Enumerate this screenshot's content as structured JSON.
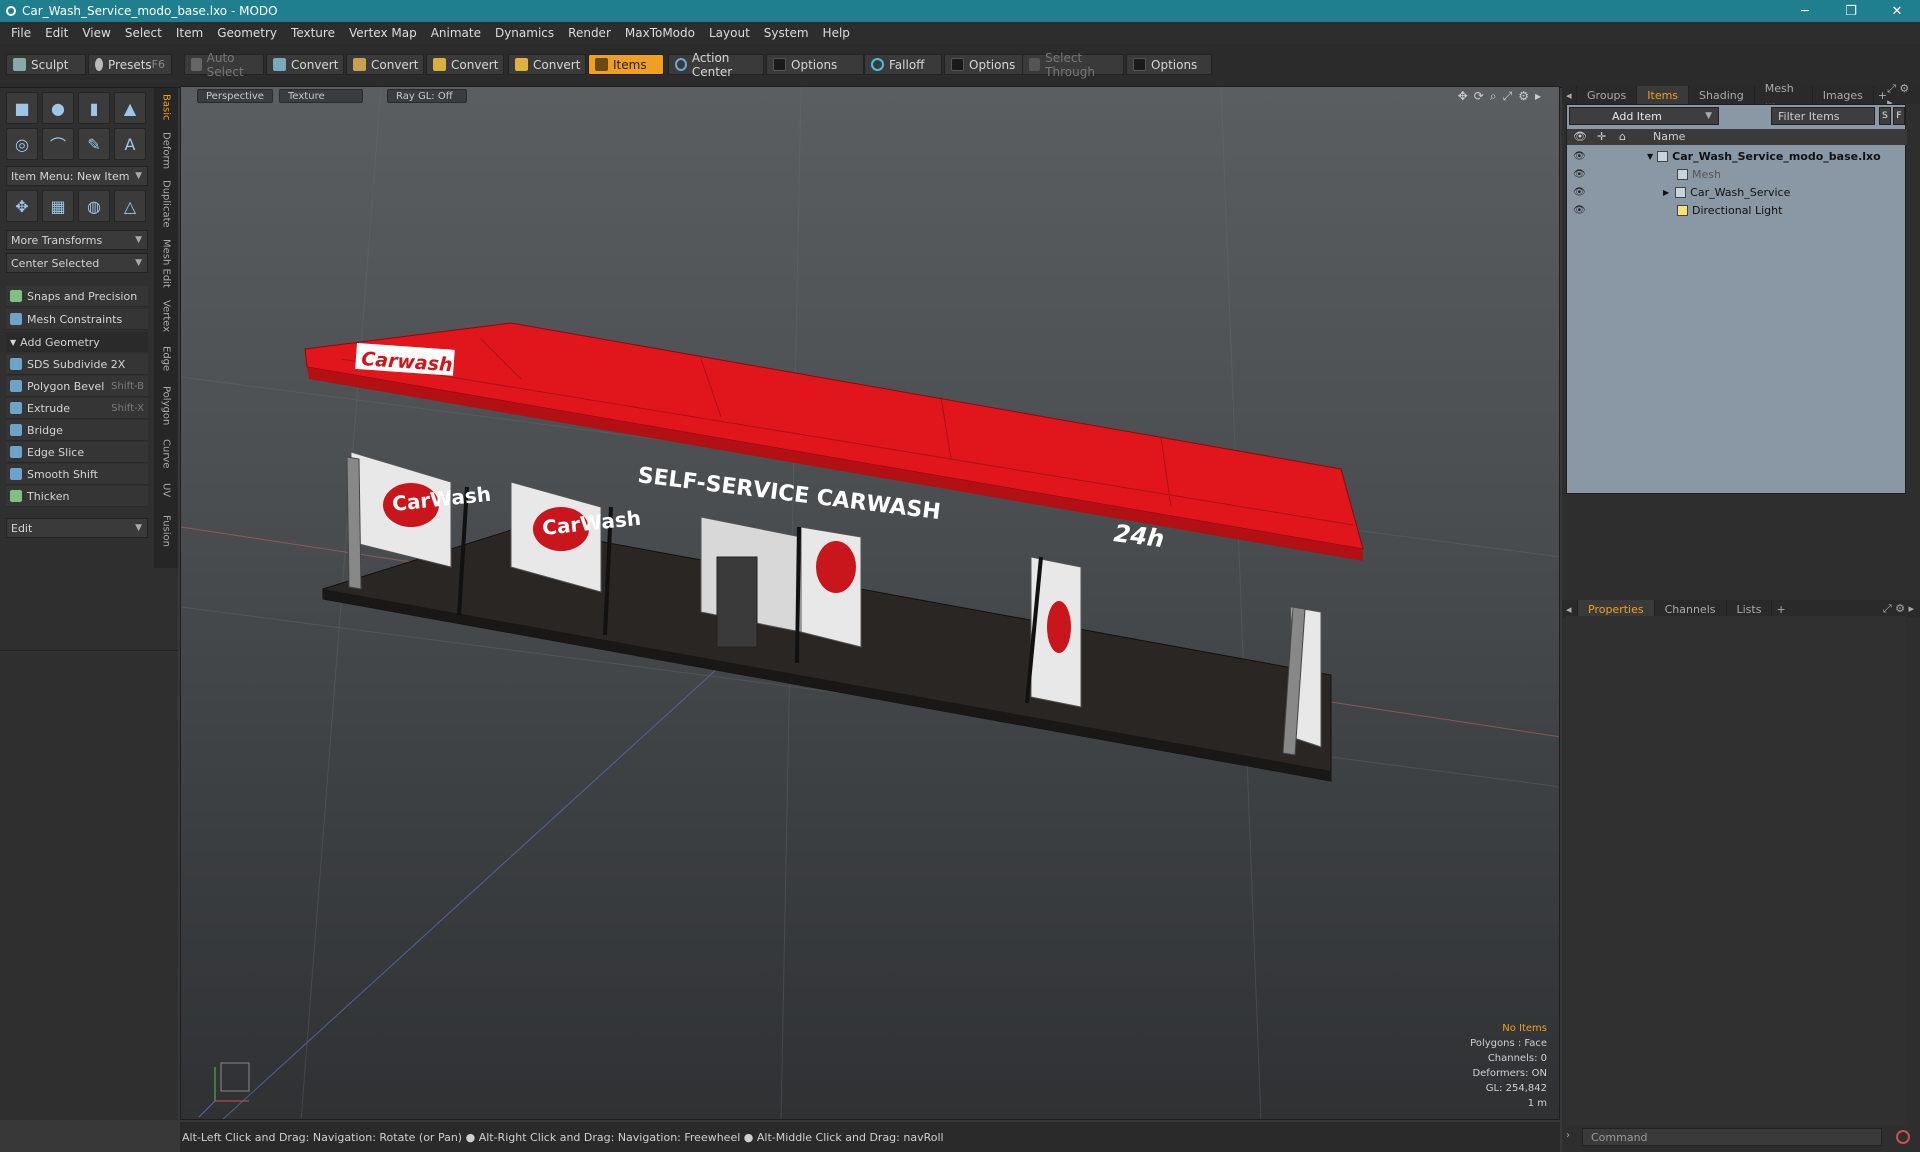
{
  "window": {
    "title": "Car_Wash_Service_modo_base.lxo - MODO",
    "controls": [
      "─",
      "❐",
      "✕"
    ]
  },
  "menu": [
    "File",
    "Edit",
    "View",
    "Select",
    "Item",
    "Geometry",
    "Texture",
    "Vertex Map",
    "Animate",
    "Dynamics",
    "Render",
    "MaxToModo",
    "Layout",
    "System",
    "Help"
  ],
  "toolbar": {
    "sculpt": "Sculpt",
    "presets": "Presets",
    "presets_key": "F6",
    "auto_select": "Auto Select",
    "convert": "Convert",
    "items": "Items",
    "action_center": "Action Center",
    "options": "Options",
    "falloff": "Falloff",
    "select_through": "Select Through"
  },
  "left_panel": {
    "vertical_tabs": [
      "Basic",
      "Deform",
      "Duplicate",
      "Mesh Edit",
      "Vertex",
      "Edge",
      "Polygon",
      "Curve",
      "UV",
      "Fusion"
    ],
    "item_menu": "Item Menu: New Item",
    "more_transforms": "More Transforms",
    "center_selected": "Center Selected",
    "snaps": "Snaps and Precision",
    "mesh_constraints": "Mesh Constraints",
    "add_geometry": "Add Geometry",
    "tools": [
      {
        "label": "SDS Subdivide 2X",
        "key": ""
      },
      {
        "label": "Polygon Bevel",
        "key": "Shift-B"
      },
      {
        "label": "Extrude",
        "key": "Shift-X"
      },
      {
        "label": "Bridge",
        "key": ""
      },
      {
        "label": "Edge Slice",
        "key": ""
      },
      {
        "label": "Smooth Shift",
        "key": ""
      },
      {
        "label": "Thicken",
        "key": ""
      }
    ],
    "edit": "Edit"
  },
  "viewport": {
    "tabs": [
      "Perspective",
      "Texture",
      "Ray GL: Off"
    ],
    "roof_sign": "SELF-SERVICE CARWASH",
    "roof_logo": "Carwash",
    "roof_24h": "24h",
    "panel_logo": "CarWash",
    "info": {
      "no_items": "No Items",
      "polygons": "Polygons : Face",
      "channels": "Channels: 0",
      "deformers": "Deformers: ON",
      "gl": "GL: 254,842",
      "scale": "1 m"
    }
  },
  "status": "Alt-Left Click and Drag: Navigation: Rotate (or Pan) ● Alt-Right Click and Drag: Navigation: Freewheel ● Alt-Middle Click and Drag: navRoll",
  "right_panel": {
    "top_tabs": [
      "Groups",
      "Items",
      "Shading",
      "Mesh ...",
      "Images"
    ],
    "add_item": "Add Item",
    "filter_items": "Filter Items",
    "col_name": "Name",
    "tree": [
      {
        "label": "Car_Wash_Service_modo_base.lxo",
        "level": 0
      },
      {
        "label": "Mesh",
        "level": 1
      },
      {
        "label": "Car_Wash_Service",
        "level": 1
      },
      {
        "label": "Directional Light",
        "level": 1
      }
    ],
    "bottom_tabs": [
      "Properties",
      "Channels",
      "Lists"
    ],
    "command_placeholder": "Command"
  }
}
